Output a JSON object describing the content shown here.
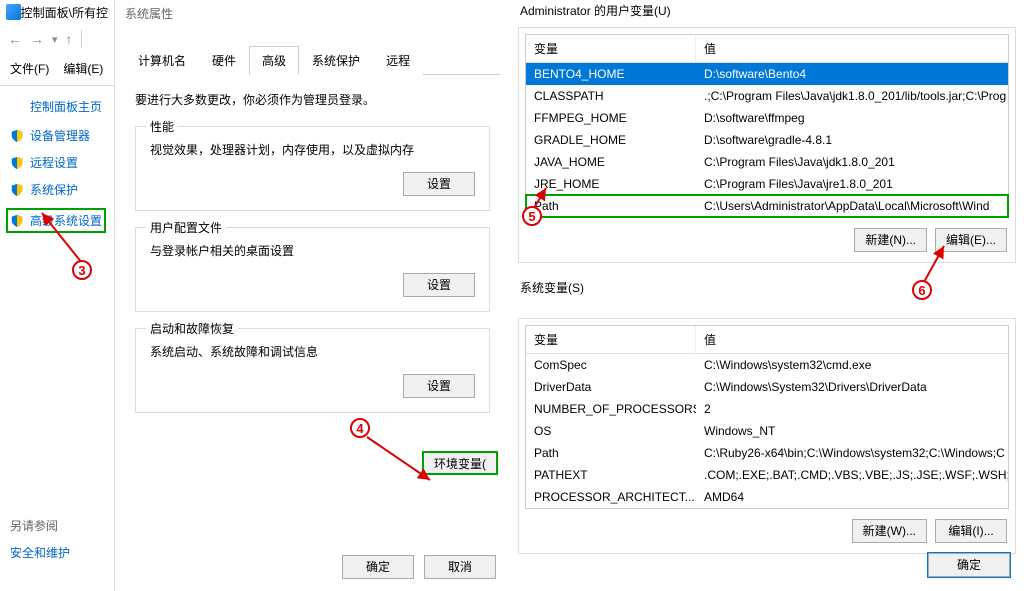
{
  "titlebar": {
    "path": "控制面板\\所有控"
  },
  "menu": {
    "file": "文件(F)",
    "edit": "编辑(E)"
  },
  "sidebar": {
    "home": "控制面板主页",
    "items": [
      {
        "label": "设备管理器"
      },
      {
        "label": "远程设置"
      },
      {
        "label": "系统保护"
      },
      {
        "label": "高级系统设置"
      }
    ],
    "see_also": "另请参阅",
    "security": "安全和维护"
  },
  "sysprops": {
    "title": "系统属性",
    "tabs": {
      "computer": "计算机名",
      "hardware": "硬件",
      "advanced": "高级",
      "protection": "系统保护",
      "remote": "远程"
    },
    "note": "要进行大多数更改，你必须作为管理员登录。",
    "perf": {
      "title": "性能",
      "text": "视觉效果，处理器计划，内存使用，以及虚拟内存",
      "btn": "设置"
    },
    "profile": {
      "title": "用户配置文件",
      "text": "与登录帐户相关的桌面设置",
      "btn": "设置"
    },
    "startup": {
      "title": "启动和故障恢复",
      "text": "系统启动、系统故障和调试信息",
      "btn": "设置"
    },
    "envbtn": "环境变量(",
    "ok": "确定",
    "cancel": "取消"
  },
  "envvars": {
    "user_title": "Administrator 的用户变量(U)",
    "cols": {
      "var": "变量",
      "val": "值"
    },
    "user_rows": [
      {
        "var": "BENTO4_HOME",
        "val": "D:\\software\\Bento4"
      },
      {
        "var": "CLASSPATH",
        "val": ".;C:\\Program Files\\Java\\jdk1.8.0_201/lib/tools.jar;C:\\Prog"
      },
      {
        "var": "FFMPEG_HOME",
        "val": "D:\\software\\ffmpeg"
      },
      {
        "var": "GRADLE_HOME",
        "val": "D:\\software\\gradle-4.8.1"
      },
      {
        "var": "JAVA_HOME",
        "val": "C:\\Program Files\\Java\\jdk1.8.0_201"
      },
      {
        "var": "JRE_HOME",
        "val": "C:\\Program Files\\Java\\jre1.8.0_201"
      },
      {
        "var": "Path",
        "val": "C:\\Users\\Administrator\\AppData\\Local\\Microsoft\\Wind"
      }
    ],
    "user_btns": {
      "new": "新建(N)...",
      "edit": "编辑(E)..."
    },
    "sys_title": "系统变量(S)",
    "sys_rows": [
      {
        "var": "ComSpec",
        "val": "C:\\Windows\\system32\\cmd.exe"
      },
      {
        "var": "DriverData",
        "val": "C:\\Windows\\System32\\Drivers\\DriverData"
      },
      {
        "var": "NUMBER_OF_PROCESSORS",
        "val": "2"
      },
      {
        "var": "OS",
        "val": "Windows_NT"
      },
      {
        "var": "Path",
        "val": "C:\\Ruby26-x64\\bin;C:\\Windows\\system32;C:\\Windows;C"
      },
      {
        "var": "PATHEXT",
        "val": ".COM;.EXE;.BAT;.CMD;.VBS;.VBE;.JS;.JSE;.WSF;.WSH;.MSC"
      },
      {
        "var": "PROCESSOR_ARCHITECT...",
        "val": "AMD64"
      }
    ],
    "sys_btns": {
      "new": "新建(W)...",
      "edit": "编辑(I)..."
    },
    "ok": "确定"
  },
  "markers": {
    "m3": "3",
    "m4": "4",
    "m5": "5",
    "m6": "6"
  }
}
